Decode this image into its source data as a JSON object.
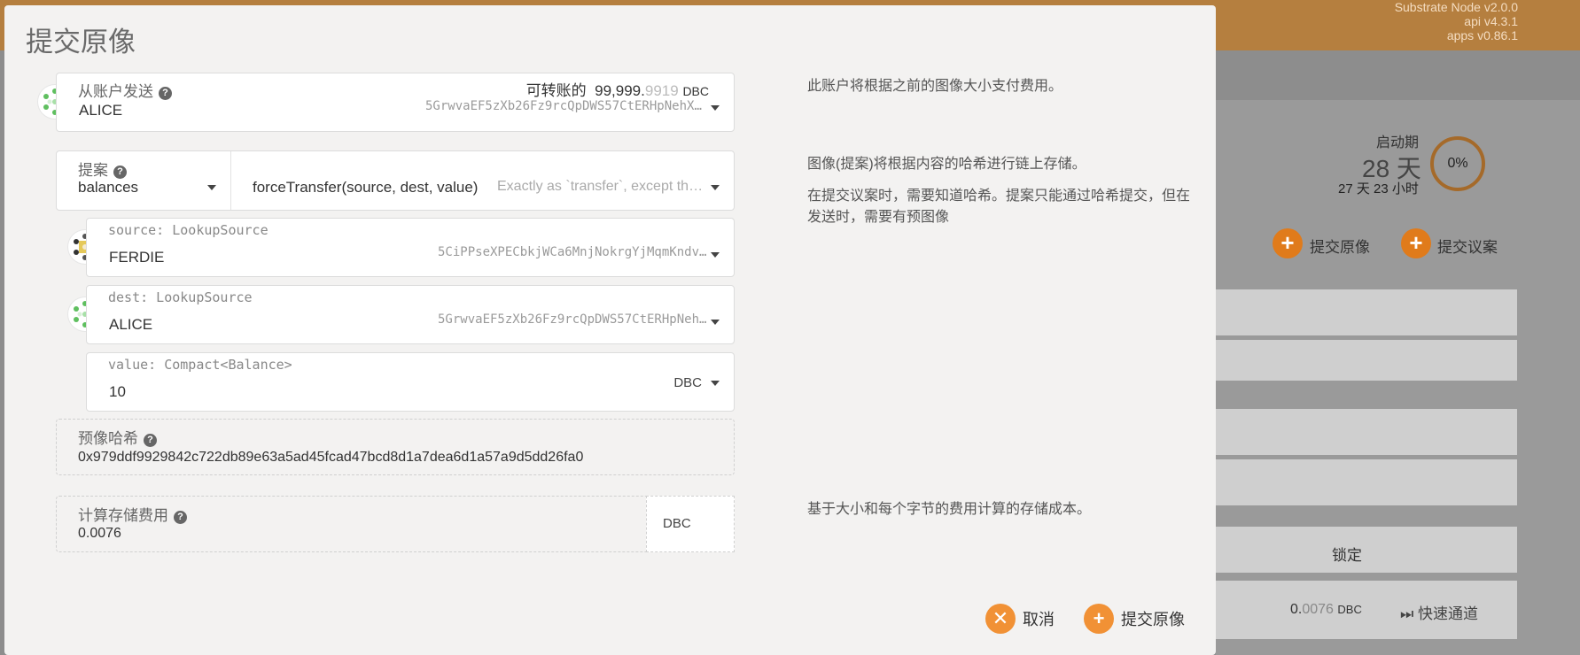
{
  "app": {
    "versions": [
      "Substrate Node v2.0.0",
      "api v4.3.1",
      "apps v0.86.1"
    ],
    "launch_period_label": "启动期",
    "launch_days": "28 天",
    "launch_remaining": "27 天 23 小时",
    "launch_percent": "0%",
    "launch_progress": 0,
    "bg_submit_preimage": "提交原像",
    "bg_submit_proposal": "提交议案",
    "bg_locked": "锁定",
    "bg_amount_int": "0.",
    "bg_amount_frac": "0076",
    "bg_amount_unit": "DBC",
    "bg_fast_track": "快速通道"
  },
  "modal": {
    "title": "提交原像",
    "from": {
      "label": "从账户发送",
      "name": "ALICE",
      "address": "5GrwvaEF5zXb26Fz9rcQpDWS57CtERHpNehXCPc…",
      "transferable_label": "可转账的",
      "transferable_int": "99,999.",
      "transferable_frac": "9919",
      "unit": "DBC",
      "help": "此账户将根据之前的图像大小支付费用。"
    },
    "proposal": {
      "label": "提案",
      "module": "balances",
      "method": "forceTransfer(source, dest, value)",
      "method_desc": "Exactly as `transfer`, except the ori…",
      "help1": "图像(提案)将根据内容的哈希进行链上存储。",
      "help2": "在提交议案时，需要知道哈希。提案只能通过哈希提交，但在发送时，需要有预图像"
    },
    "source": {
      "label": "source: LookupSource",
      "name": "FERDIE",
      "address": "5CiPPseXPECbkjWCa6MnjNokrgYjMqmKndv2rS…"
    },
    "dest": {
      "label": "dest: LookupSource",
      "name": "ALICE",
      "address": "5GrwvaEF5zXb26Fz9rcQpDWS57CtERHpNehXCP…"
    },
    "value": {
      "label": "value: Compact<Balance>",
      "amount": "10",
      "unit": "DBC"
    },
    "hash": {
      "label": "预像哈希",
      "value": "0x979ddf9929842c722db89e63a5ad45fcad47bcd8d1a7dea6d1a57a9d5dd26fa0"
    },
    "fee": {
      "label": "计算存储费用",
      "value": "0.0076",
      "unit": "DBC",
      "help": "基于大小和每个字节的费用计算的存储成本。"
    },
    "cancel_label": "取消",
    "submit_label": "提交原像"
  },
  "colors": {
    "accent": "#f19135",
    "topbar": "#b57f3f"
  },
  "icons": {
    "cancel": "x-icon",
    "submit": "plus-icon",
    "help": "question-icon",
    "fast": "fast-forward-icon"
  }
}
